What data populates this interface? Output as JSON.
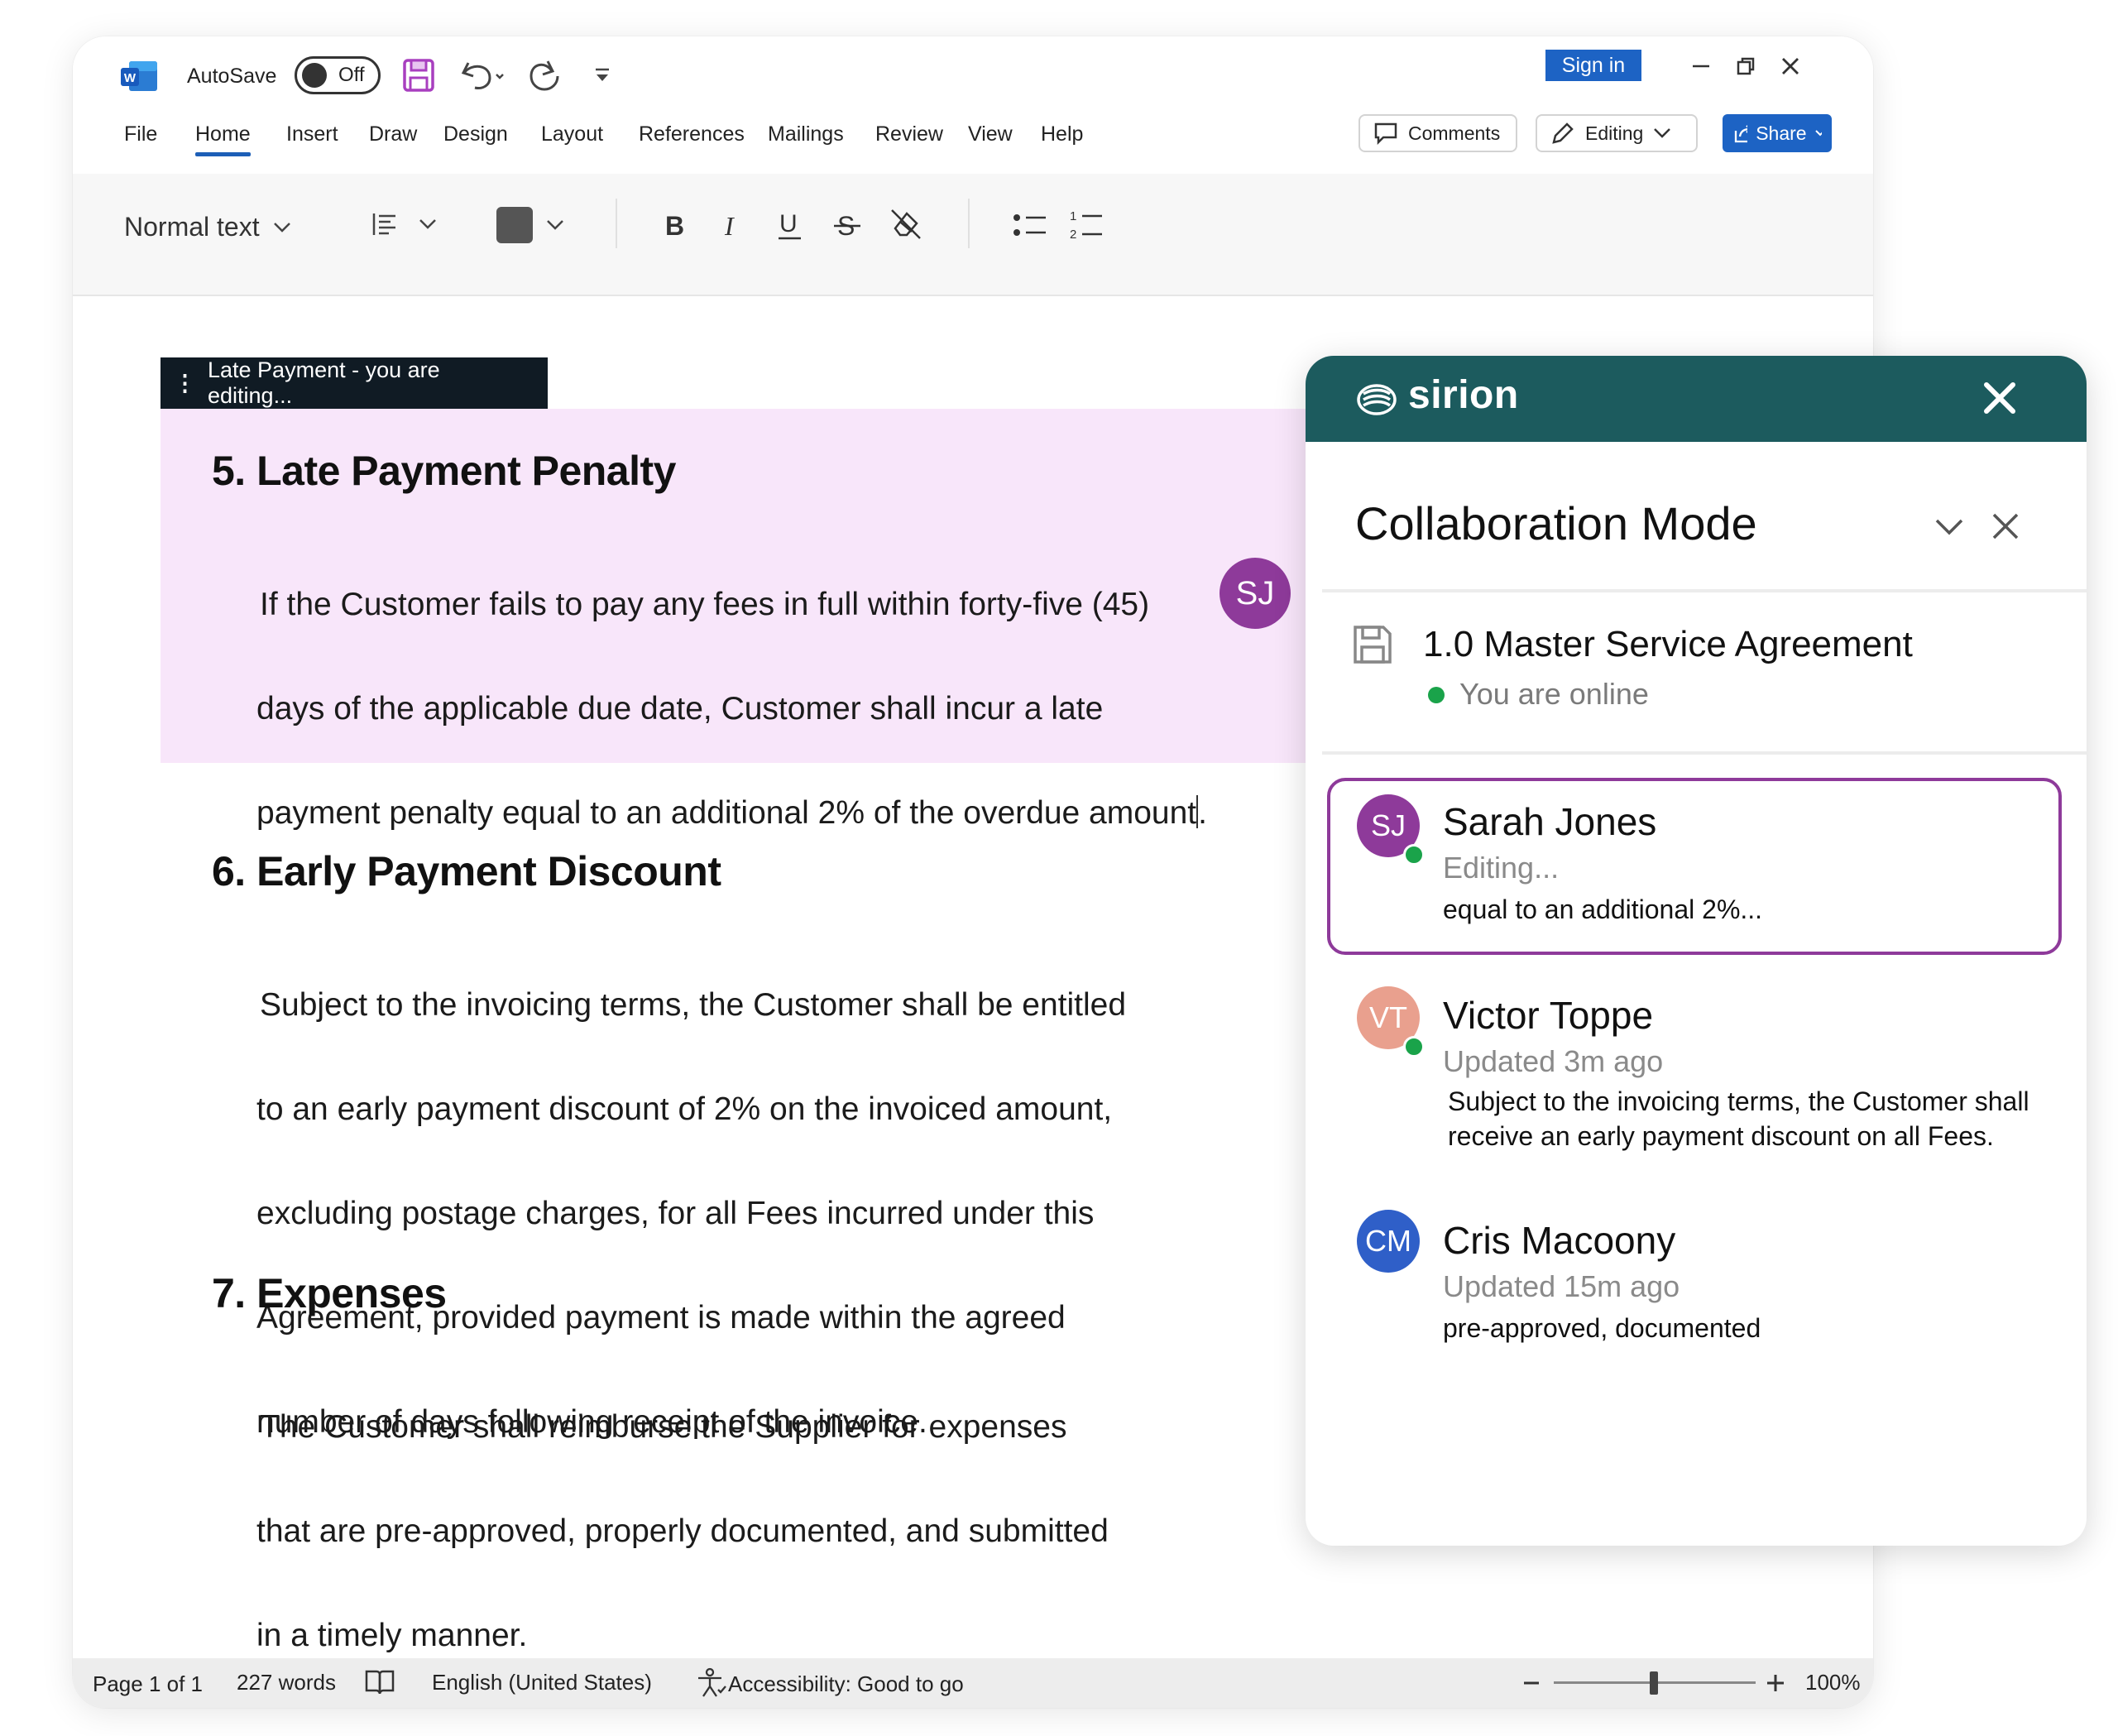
{
  "app": {
    "autosave_label": "AutoSave",
    "autosave_state": "Off",
    "sign_in": "Sign in",
    "menu": [
      "File",
      "Home",
      "Insert",
      "Draw",
      "Design",
      "Layout",
      "References",
      "Mailings",
      "Review",
      "View",
      "Help"
    ],
    "active_menu": "Home",
    "comments_label": "Comments",
    "editing_label": "Editing",
    "share_label": "Share",
    "style_label": "Normal text"
  },
  "document": {
    "editing_tag": "Late Payment - you are editing...",
    "sections": [
      {
        "heading": "5. Late Payment Penalty",
        "lines": [
          "If the Customer fails to pay any fees in full within forty-five (45)",
          "days of the applicable due date, Customer shall incur a late",
          "payment penalty equal to an additional 2% of the overdue amount"
        ],
        "trailing": "."
      },
      {
        "heading": "6. Early Payment Discount",
        "lines": [
          "Subject to the invoicing terms, the Customer shall be entitled",
          "to an early payment discount of 2% on the invoiced amount,",
          "excluding postage charges, for all Fees incurred under this",
          "Agreement, provided payment is made within the agreed",
          "number of days following receipt of the invoice."
        ]
      },
      {
        "heading": "7. Expenses",
        "lines": [
          "The Customer shall reimburse the Supplier for expenses",
          "that are pre-approved, properly documented, and submitted",
          "in a timely manner."
        ]
      }
    ],
    "cursor_user": "SJ"
  },
  "status": {
    "page": "Page 1 of 1",
    "words": "227 words",
    "language": "English (United States)",
    "accessibility": "Accessibility: Good to go",
    "zoom": "100%",
    "zoom_value": 100
  },
  "panel": {
    "brand": "sirion",
    "title": "Collaboration Mode",
    "doc_title": "1.0 Master Service Agreement",
    "presence": "You are online",
    "users": [
      {
        "initials": "SJ",
        "name": "Sarah Jones",
        "status": "Editing...",
        "snippet": "equal to an additional 2%...",
        "color": "#8e3a9a",
        "online": true,
        "active": true
      },
      {
        "initials": "VT",
        "name": "Victor Toppe",
        "status": "Updated 3m ago",
        "snippet": "Subject to the invoicing terms, the Customer shall receive an early payment discount on all Fees.",
        "snippet_lines": [
          "Subject to the invoicing terms, the Customer shall",
          "receive an early payment discount on all Fees."
        ],
        "color": "#e9a08e",
        "online": true,
        "active": false
      },
      {
        "initials": "CM",
        "name": "Cris Macoony",
        "status": "Updated 15m ago",
        "snippet": "pre-approved, documented",
        "color": "#2f5fc8",
        "online": false,
        "active": false
      }
    ]
  },
  "colors": {
    "accent_blue": "#1d63c4",
    "panel_header": "#1c5b5e",
    "highlight": "#f8e6fa",
    "active_border": "#8e3a9a",
    "online": "#1aa34a"
  }
}
